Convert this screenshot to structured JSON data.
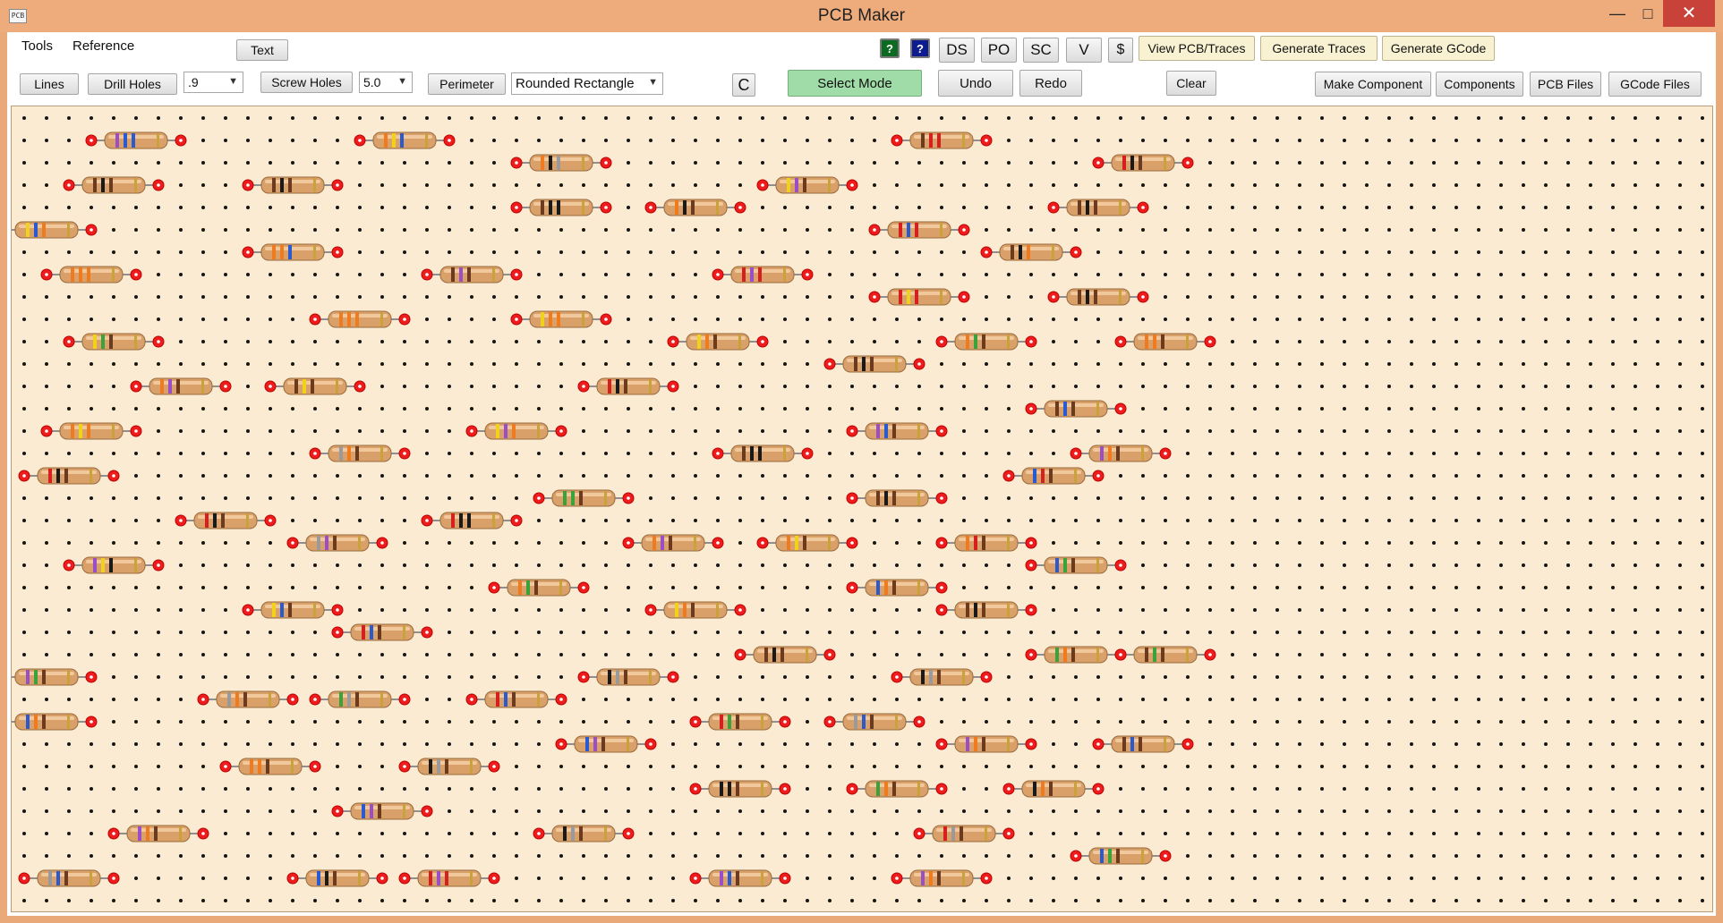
{
  "window": {
    "title": "PCB Maker",
    "icon_label": "PCB"
  },
  "menu": {
    "items": [
      "Tools",
      "Reference"
    ]
  },
  "toolbar1": {
    "text_label": "Text",
    "help_green": "?",
    "help_blue": "?",
    "ds": "DS",
    "po": "PO",
    "sc": "SC",
    "v": "V",
    "dollar": "$",
    "view_pcb": "View PCB/Traces",
    "gen_traces": "Generate Traces",
    "gen_gcode": "Generate GCode"
  },
  "toolbar2": {
    "lines": "Lines",
    "drill_holes": "Drill Holes",
    "drill_size": ".9",
    "screw_holes": "Screw Holes",
    "screw_size": "5.0",
    "perimeter": "Perimeter",
    "perimeter_shape": "Rounded Rectangle",
    "c_label": "C",
    "select_mode": "Select Mode",
    "undo": "Undo",
    "redo": "Redo",
    "clear": "Clear",
    "make_component": "Make Component",
    "components": "Components",
    "pcb_files": "PCB Files",
    "gcode_files": "GCode Files"
  },
  "colors": {
    "board": "#fbebd2",
    "grid_dot": "#151515",
    "pad": "#ee1c1c",
    "resistor_body": "#d9a06a",
    "select_mode_bg": "#9fdca7"
  },
  "components": [
    {
      "type": "resistor",
      "row": 1,
      "col": 3,
      "bands": [
        "purple",
        "blue",
        "blue"
      ]
    },
    {
      "type": "resistor",
      "row": 1,
      "col": 15,
      "bands": [
        "orange",
        "yellow",
        "blue"
      ]
    },
    {
      "type": "resistor",
      "row": 1,
      "col": 39,
      "bands": [
        "brown",
        "red",
        "red"
      ]
    },
    {
      "type": "resistor",
      "row": 2,
      "col": 22,
      "bands": [
        "orange",
        "black",
        "grey"
      ]
    },
    {
      "type": "resistor",
      "row": 2,
      "col": 48,
      "bands": [
        "red",
        "black",
        "brown"
      ]
    },
    {
      "type": "resistor",
      "row": 3,
      "col": 2,
      "bands": [
        "brown",
        "black",
        "brown"
      ]
    },
    {
      "type": "resistor",
      "row": 3,
      "col": 10,
      "bands": [
        "brown",
        "black",
        "brown"
      ]
    },
    {
      "type": "resistor",
      "row": 3,
      "col": 33,
      "bands": [
        "yellow",
        "purple",
        "brown"
      ]
    },
    {
      "type": "resistor",
      "row": 4,
      "col": 22,
      "bands": [
        "brown",
        "black",
        "black"
      ]
    },
    {
      "type": "resistor",
      "row": 4,
      "col": 28,
      "bands": [
        "orange",
        "black",
        "brown"
      ]
    },
    {
      "type": "resistor",
      "row": 4,
      "col": 46,
      "bands": [
        "brown",
        "black",
        "brown"
      ]
    },
    {
      "type": "resistor",
      "row": 5,
      "col": -1,
      "bands": [
        "yellow",
        "blue",
        "orange"
      ]
    },
    {
      "type": "resistor",
      "row": 5,
      "col": 38,
      "bands": [
        "red",
        "blue",
        "red"
      ]
    },
    {
      "type": "resistor",
      "row": 6,
      "col": 10,
      "bands": [
        "orange",
        "orange",
        "blue"
      ]
    },
    {
      "type": "resistor",
      "row": 6,
      "col": 43,
      "bands": [
        "brown",
        "black",
        "orange"
      ]
    },
    {
      "type": "resistor",
      "row": 7,
      "col": 1,
      "bands": [
        "orange",
        "orange",
        "orange"
      ]
    },
    {
      "type": "resistor",
      "row": 7,
      "col": 18,
      "bands": [
        "brown",
        "purple",
        "brown"
      ]
    },
    {
      "type": "resistor",
      "row": 7,
      "col": 31,
      "bands": [
        "red",
        "purple",
        "red"
      ]
    },
    {
      "type": "resistor",
      "row": 8,
      "col": 38,
      "bands": [
        "red",
        "yellow",
        "red"
      ]
    },
    {
      "type": "resistor",
      "row": 8,
      "col": 46,
      "bands": [
        "brown",
        "black",
        "brown"
      ]
    },
    {
      "type": "resistor",
      "row": 9,
      "col": 13,
      "bands": [
        "orange",
        "orange",
        "orange"
      ]
    },
    {
      "type": "resistor",
      "row": 9,
      "col": 22,
      "bands": [
        "yellow",
        "orange",
        "orange"
      ]
    },
    {
      "type": "resistor",
      "row": 10,
      "col": 2,
      "bands": [
        "yellow",
        "green",
        "brown"
      ]
    },
    {
      "type": "resistor",
      "row": 10,
      "col": 29,
      "bands": [
        "yellow",
        "orange",
        "brown"
      ]
    },
    {
      "type": "resistor",
      "row": 10,
      "col": 41,
      "bands": [
        "orange",
        "green",
        "brown"
      ]
    },
    {
      "type": "resistor",
      "row": 10,
      "col": 49,
      "bands": [
        "orange",
        "orange",
        "brown"
      ]
    },
    {
      "type": "resistor",
      "row": 11,
      "col": 36,
      "bands": [
        "brown",
        "black",
        "brown"
      ]
    },
    {
      "type": "resistor",
      "row": 12,
      "col": 5,
      "bands": [
        "orange",
        "purple",
        "brown"
      ]
    },
    {
      "type": "resistor",
      "row": 12,
      "col": 11,
      "bands": [
        "brown",
        "yellow",
        "brown"
      ]
    },
    {
      "type": "resistor",
      "row": 12,
      "col": 25,
      "bands": [
        "red",
        "black",
        "brown"
      ]
    },
    {
      "type": "resistor",
      "row": 13,
      "col": 45,
      "bands": [
        "brown",
        "blue",
        "brown"
      ]
    },
    {
      "type": "resistor",
      "row": 14,
      "col": 1,
      "bands": [
        "orange",
        "yellow",
        "orange"
      ]
    },
    {
      "type": "resistor",
      "row": 14,
      "col": 20,
      "bands": [
        "yellow",
        "purple",
        "orange"
      ]
    },
    {
      "type": "resistor",
      "row": 14,
      "col": 37,
      "bands": [
        "purple",
        "blue",
        "brown"
      ]
    },
    {
      "type": "resistor",
      "row": 15,
      "col": 13,
      "bands": [
        "grey",
        "orange",
        "brown"
      ]
    },
    {
      "type": "resistor",
      "row": 15,
      "col": 31,
      "bands": [
        "brown",
        "black",
        "black"
      ]
    },
    {
      "type": "resistor",
      "row": 15,
      "col": 47,
      "bands": [
        "purple",
        "orange",
        "brown"
      ]
    },
    {
      "type": "resistor",
      "row": 16,
      "col": 0,
      "bands": [
        "red",
        "black",
        "brown"
      ]
    },
    {
      "type": "resistor",
      "row": 16,
      "col": 44,
      "bands": [
        "blue",
        "red",
        "brown"
      ]
    },
    {
      "type": "resistor",
      "row": 17,
      "col": 23,
      "bands": [
        "green",
        "green",
        "brown"
      ]
    },
    {
      "type": "resistor",
      "row": 17,
      "col": 37,
      "bands": [
        "brown",
        "black",
        "brown"
      ]
    },
    {
      "type": "resistor",
      "row": 18,
      "col": 7,
      "bands": [
        "red",
        "black",
        "brown"
      ]
    },
    {
      "type": "resistor",
      "row": 18,
      "col": 18,
      "bands": [
        "red",
        "black",
        "black"
      ]
    },
    {
      "type": "resistor",
      "row": 19,
      "col": 12,
      "bands": [
        "grey",
        "purple",
        "brown"
      ]
    },
    {
      "type": "resistor",
      "row": 19,
      "col": 27,
      "bands": [
        "orange",
        "purple",
        "brown"
      ]
    },
    {
      "type": "resistor",
      "row": 19,
      "col": 33,
      "bands": [
        "orange",
        "yellow",
        "brown"
      ]
    },
    {
      "type": "resistor",
      "row": 19,
      "col": 41,
      "bands": [
        "orange",
        "red",
        "brown"
      ]
    },
    {
      "type": "resistor",
      "row": 20,
      "col": 2,
      "bands": [
        "purple",
        "yellow",
        "black"
      ]
    },
    {
      "type": "resistor",
      "row": 20,
      "col": 45,
      "bands": [
        "blue",
        "green",
        "brown"
      ]
    },
    {
      "type": "resistor",
      "row": 21,
      "col": 21,
      "bands": [
        "orange",
        "green",
        "brown"
      ]
    },
    {
      "type": "resistor",
      "row": 21,
      "col": 37,
      "bands": [
        "blue",
        "orange",
        "brown"
      ]
    },
    {
      "type": "resistor",
      "row": 22,
      "col": 10,
      "bands": [
        "yellow",
        "blue",
        "brown"
      ]
    },
    {
      "type": "resistor",
      "row": 22,
      "col": 28,
      "bands": [
        "yellow",
        "orange",
        "brown"
      ]
    },
    {
      "type": "resistor",
      "row": 22,
      "col": 41,
      "bands": [
        "brown",
        "black",
        "brown"
      ]
    },
    {
      "type": "resistor",
      "row": 23,
      "col": 14,
      "bands": [
        "red",
        "blue",
        "brown"
      ]
    },
    {
      "type": "resistor",
      "row": 24,
      "col": 32,
      "bands": [
        "brown",
        "black",
        "brown"
      ]
    },
    {
      "type": "resistor",
      "row": 24,
      "col": 45,
      "bands": [
        "green",
        "orange",
        "brown"
      ]
    },
    {
      "type": "resistor",
      "row": 24,
      "col": 49,
      "bands": [
        "brown",
        "green",
        "brown"
      ]
    },
    {
      "type": "resistor",
      "row": 25,
      "col": -1,
      "bands": [
        "purple",
        "green",
        "brown"
      ]
    },
    {
      "type": "resistor",
      "row": 25,
      "col": 25,
      "bands": [
        "black",
        "grey",
        "brown"
      ]
    },
    {
      "type": "resistor",
      "row": 25,
      "col": 39,
      "bands": [
        "black",
        "grey",
        "brown"
      ]
    },
    {
      "type": "resistor",
      "row": 26,
      "col": 8,
      "bands": [
        "grey",
        "orange",
        "brown"
      ]
    },
    {
      "type": "resistor",
      "row": 26,
      "col": 13,
      "bands": [
        "green",
        "grey",
        "brown"
      ]
    },
    {
      "type": "resistor",
      "row": 26,
      "col": 20,
      "bands": [
        "red",
        "blue",
        "brown"
      ]
    },
    {
      "type": "resistor",
      "row": 27,
      "col": -1,
      "bands": [
        "blue",
        "orange",
        "brown"
      ]
    },
    {
      "type": "resistor",
      "row": 27,
      "col": 30,
      "bands": [
        "red",
        "green",
        "brown"
      ]
    },
    {
      "type": "resistor",
      "row": 27,
      "col": 36,
      "bands": [
        "grey",
        "blue",
        "brown"
      ]
    },
    {
      "type": "resistor",
      "row": 28,
      "col": 24,
      "bands": [
        "blue",
        "purple",
        "brown"
      ]
    },
    {
      "type": "resistor",
      "row": 28,
      "col": 41,
      "bands": [
        "purple",
        "orange",
        "brown"
      ]
    },
    {
      "type": "resistor",
      "row": 28,
      "col": 48,
      "bands": [
        "brown",
        "blue",
        "brown"
      ]
    },
    {
      "type": "resistor",
      "row": 29,
      "col": 9,
      "bands": [
        "orange",
        "orange",
        "brown"
      ]
    },
    {
      "type": "resistor",
      "row": 29,
      "col": 17,
      "bands": [
        "black",
        "grey",
        "brown"
      ]
    },
    {
      "type": "resistor",
      "row": 30,
      "col": 30,
      "bands": [
        "black",
        "black",
        "brown"
      ]
    },
    {
      "type": "resistor",
      "row": 30,
      "col": 37,
      "bands": [
        "green",
        "orange",
        "brown"
      ]
    },
    {
      "type": "resistor",
      "row": 30,
      "col": 44,
      "bands": [
        "black",
        "orange",
        "brown"
      ]
    },
    {
      "type": "resistor",
      "row": 31,
      "col": 14,
      "bands": [
        "blue",
        "purple",
        "brown"
      ]
    },
    {
      "type": "resistor",
      "row": 32,
      "col": 4,
      "bands": [
        "purple",
        "orange",
        "brown"
      ]
    },
    {
      "type": "resistor",
      "row": 32,
      "col": 23,
      "bands": [
        "black",
        "grey",
        "brown"
      ]
    },
    {
      "type": "resistor",
      "row": 32,
      "col": 40,
      "bands": [
        "red",
        "grey",
        "brown"
      ]
    },
    {
      "type": "resistor",
      "row": 33,
      "col": 47,
      "bands": [
        "blue",
        "green",
        "brown"
      ]
    },
    {
      "type": "resistor",
      "row": 34,
      "col": 0,
      "bands": [
        "grey",
        "blue",
        "brown"
      ]
    },
    {
      "type": "resistor",
      "row": 34,
      "col": 12,
      "bands": [
        "blue",
        "black",
        "brown"
      ]
    },
    {
      "type": "resistor",
      "row": 34,
      "col": 17,
      "bands": [
        "red",
        "purple",
        "red"
      ]
    },
    {
      "type": "resistor",
      "row": 34,
      "col": 30,
      "bands": [
        "purple",
        "blue",
        "brown"
      ]
    },
    {
      "type": "resistor",
      "row": 34,
      "col": 39,
      "bands": [
        "purple",
        "orange",
        "brown"
      ]
    }
  ]
}
